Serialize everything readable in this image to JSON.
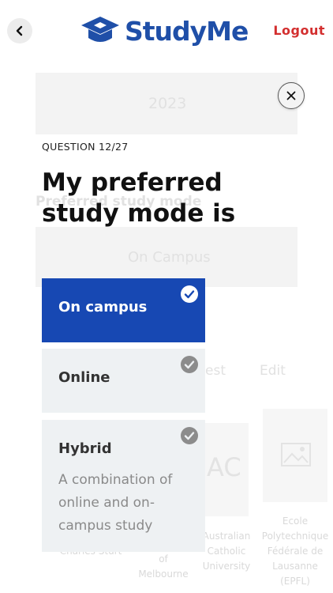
{
  "header": {
    "back_icon": "chevron-left-icon",
    "logo_icon": "graduation-cap-icon",
    "logo_text": "StudyMe",
    "logout_label": "Logout"
  },
  "background": {
    "year": "2023",
    "preferred_mode_label": "Preferred study mode",
    "preferred_mode_value": "On Campus",
    "test_label": "est",
    "edit_label": "Edit",
    "universities": [
      "Charles Sturt",
      "of\nMelbourne",
      "Australian\nCatholic\nUniversity",
      "Ecole\nPolytechnique\nFédérale de\nLausanne\n(EPFL)"
    ],
    "logo_ac": "AC"
  },
  "dialog": {
    "close_icon": "close-icon",
    "question_counter": "QUESTION 12/27",
    "question_title": "My preferred study mode is",
    "options": [
      {
        "label": "On campus",
        "description": "",
        "selected": true
      },
      {
        "label": "Online",
        "description": "",
        "selected": false
      },
      {
        "label": "Hybrid",
        "description": "A combination of online and on-campus study",
        "selected": false
      }
    ]
  },
  "colors": {
    "brand": "#1f4fa8",
    "selected_option": "#1748b3",
    "logout": "#d32f2f",
    "option_bg": "#eef1f3"
  }
}
